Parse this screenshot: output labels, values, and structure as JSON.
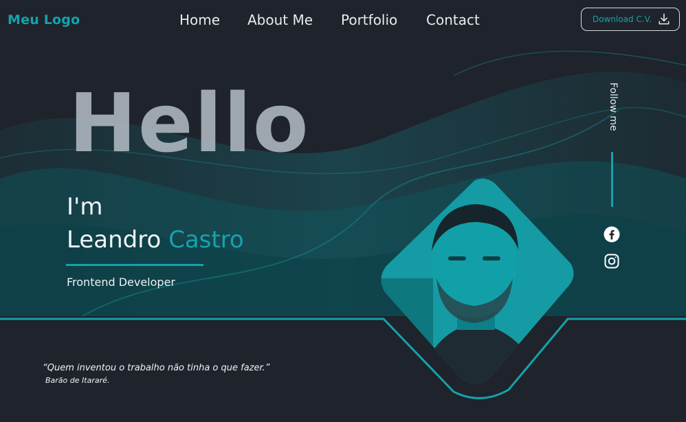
{
  "brand": {
    "logo_text": "Meu Logo"
  },
  "nav": {
    "items": [
      {
        "label": "Home"
      },
      {
        "label": "About Me"
      },
      {
        "label": "Portfolio"
      },
      {
        "label": "Contact"
      }
    ],
    "cv_button": {
      "label": "Download C.V.",
      "icon": "download-icon"
    }
  },
  "hero": {
    "greeting": "Hello",
    "intro": "I'm",
    "first_name": "Leandro",
    "last_name": "Castro",
    "role": "Frontend Developer"
  },
  "quote": {
    "text": "“Quem inventou o trabalho não tinha o que fazer.”",
    "author": "Barão de Itararé."
  },
  "social": {
    "follow_label": "Follow me",
    "links": [
      {
        "icon": "facebook-icon"
      },
      {
        "icon": "instagram-icon"
      }
    ]
  },
  "colors": {
    "background": "#1f232b",
    "accent": "#14a3ad",
    "text": "#e8ecef",
    "hello": "#a9b3bb"
  }
}
